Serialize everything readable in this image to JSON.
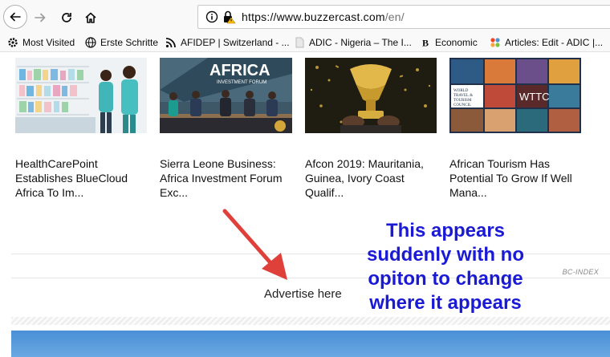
{
  "browser": {
    "url_main": "https://www.buzzercast.com",
    "url_path": "/en/",
    "bookmarks": [
      {
        "label": "Most Visited",
        "icon": "gear-icon"
      },
      {
        "label": "Erste Schritte",
        "icon": "globe-icon"
      },
      {
        "label": "AFIDEP | Switzerland - ...",
        "icon": "rss-icon"
      },
      {
        "label": "ADIC - Nigeria – The I...",
        "icon": "page-icon"
      },
      {
        "label": "Economic",
        "icon": "b-icon"
      },
      {
        "label": "Articles: Edit - ADIC",
        "icon": "joomla-icon"
      },
      {
        "label": "|...",
        "icon": ""
      }
    ]
  },
  "articles": [
    {
      "title_lines": [
        "HealthCarePoint",
        "Establishes BlueCloud",
        "Africa To Im..."
      ]
    },
    {
      "title_lines": [
        "Sierra Leone Business:",
        "Africa Investment Forum",
        "Exc..."
      ],
      "image_text": "AFRICA",
      "image_subtext": "INVESTMENT FORUM"
    },
    {
      "title_lines": [
        "Afcon 2019: Mauritania,",
        "Guinea, Ivory Coast",
        "Qualif..."
      ]
    },
    {
      "title_lines": [
        "African Tourism Has",
        "Potential To Grow If Well",
        "Mana..."
      ],
      "image_text": "WTTC",
      "image_subtext_lines": [
        "WORLD",
        "TRAVEL &",
        "TOURISM",
        "COUNCIL"
      ]
    }
  ],
  "ad": {
    "bc_index": "BC-INDEX",
    "advertise": "Advertise here"
  },
  "annotation": {
    "lines": [
      "This appears",
      "suddenly with no",
      "opiton to change",
      "where it appears"
    ],
    "color": "#1a1ad6",
    "arrow_color": "#e0403a"
  }
}
